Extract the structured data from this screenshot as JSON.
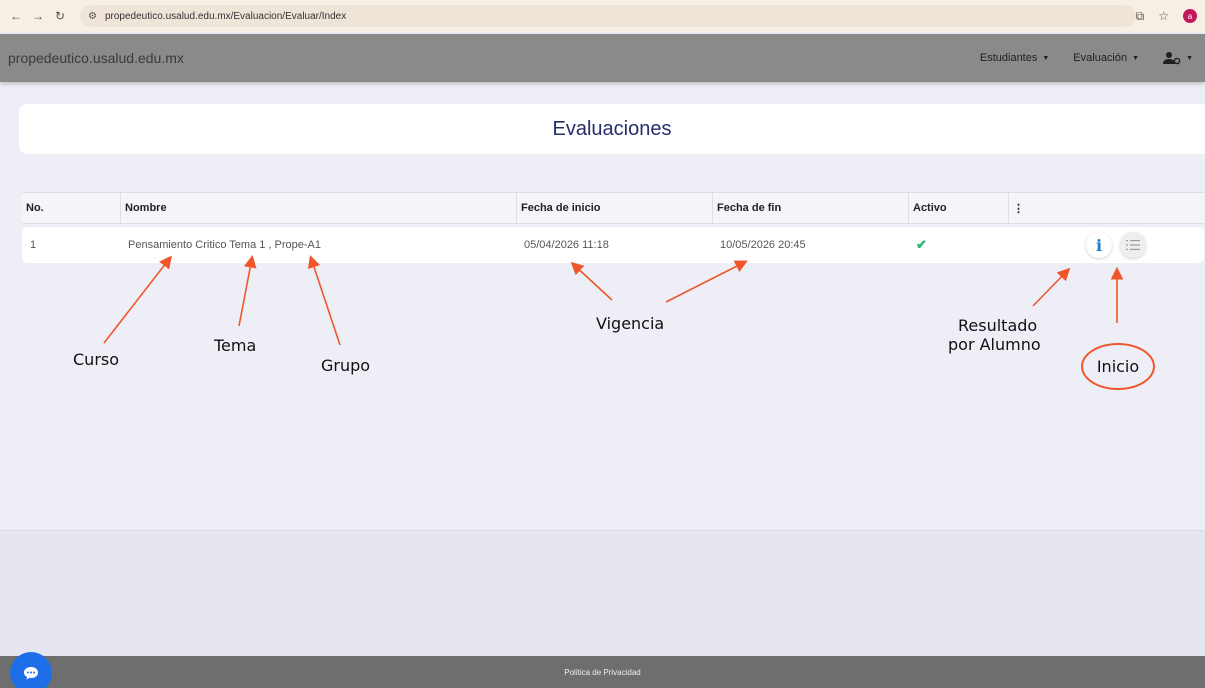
{
  "browser": {
    "url": "propedeutico.usalud.edu.mx/Evaluacion/Evaluar/Index",
    "profile_initial": "a"
  },
  "navbar": {
    "brand": "propedeutico.usalud.edu.mx",
    "items": [
      {
        "label": "Estudiantes"
      },
      {
        "label": "Evaluación"
      }
    ]
  },
  "page": {
    "title": "Evaluaciones"
  },
  "table": {
    "headers": [
      "No.",
      "Nombre",
      "Fecha de inicio",
      "Fecha de fin",
      "Activo",
      "⋮"
    ],
    "rows": [
      {
        "no": "1",
        "nombre": "Pensamiento Critico Tema 1 , Prope-A1",
        "fecha_inicio": "05/04/2026 11:18",
        "fecha_fin": "10/05/2026 20:45",
        "activo": "✔"
      }
    ]
  },
  "annotations": {
    "curso": "Curso",
    "tema": "Tema",
    "grupo": "Grupo",
    "vigencia": "Vigencia",
    "resultado_line1": "Resultado",
    "resultado_line2": "por Alumno",
    "inicio": "Inicio",
    "arrow_color": "#f0562b"
  },
  "footer": {
    "link": "Politica de Privacidad"
  },
  "icons": {
    "info": "info-icon",
    "list": "list-icon",
    "chat": "chat-icon",
    "user": "user-settings-icon"
  }
}
